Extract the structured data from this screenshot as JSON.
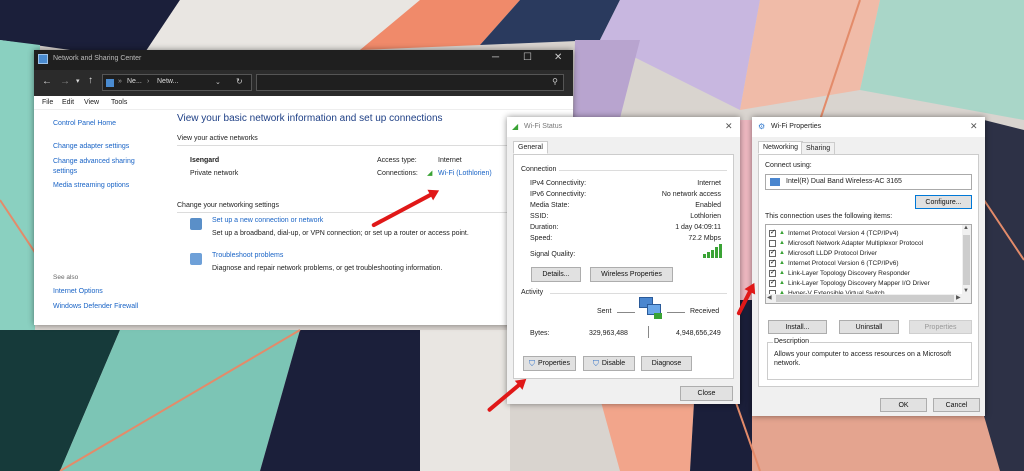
{
  "network_center": {
    "title": "Network and Sharing Center",
    "nav": {
      "path1": "Ne...",
      "path2": "Netw..."
    },
    "menu": [
      "File",
      "Edit",
      "View",
      "Tools"
    ],
    "sidebar": {
      "items": [
        "Control Panel Home",
        "Change adapter settings",
        "Change advanced sharing settings",
        "Media streaming options"
      ],
      "see_also_heading": "See also",
      "see_also": [
        "Internet Options",
        "Windows Defender Firewall"
      ]
    },
    "main": {
      "heading": "View your basic network information and set up connections",
      "active_heading": "View your active networks",
      "network_name": "Isengard",
      "network_type": "Private network",
      "access_type_label": "Access type:",
      "access_type_value": "Internet",
      "connections_label": "Connections:",
      "connections_value": "Wi-Fi (Lothlorien)",
      "change_heading": "Change your networking settings",
      "task1_title": "Set up a new connection or network",
      "task1_desc": "Set up a broadband, dial-up, or VPN connection; or set up a router or access point.",
      "task2_title": "Troubleshoot problems",
      "task2_desc": "Diagnose and repair network problems, or get troubleshooting information."
    }
  },
  "wifi_status": {
    "title": "Wi-Fi Status",
    "tab": "General",
    "connection_heading": "Connection",
    "rows": [
      {
        "label": "IPv4 Connectivity:",
        "value": "Internet"
      },
      {
        "label": "IPv6 Connectivity:",
        "value": "No network access"
      },
      {
        "label": "Media State:",
        "value": "Enabled"
      },
      {
        "label": "SSID:",
        "value": "Lothlorien"
      },
      {
        "label": "Duration:",
        "value": "1 day 04:09:11"
      },
      {
        "label": "Speed:",
        "value": "72.2 Mbps"
      }
    ],
    "signal_label": "Signal Quality:",
    "details_btn": "Details...",
    "wireless_props_btn": "Wireless Properties",
    "activity_heading": "Activity",
    "sent_label": "Sent",
    "received_label": "Received",
    "bytes_label": "Bytes:",
    "bytes_sent": "329,963,488",
    "bytes_received": "4,948,656,249",
    "properties_btn": "Properties",
    "disable_btn": "Disable",
    "diagnose_btn": "Diagnose",
    "close_btn": "Close"
  },
  "wifi_props": {
    "title": "Wi-Fi Properties",
    "tabs": [
      "Networking",
      "Sharing"
    ],
    "connect_using_label": "Connect using:",
    "adapter": "Intel(R) Dual Band Wireless-AC 3165",
    "configure_btn": "Configure...",
    "items_label": "This connection uses the following items:",
    "items": [
      {
        "label": "Internet Protocol Version 4 (TCP/IPv4)",
        "checked": true
      },
      {
        "label": "Microsoft Network Adapter Multiplexor Protocol",
        "checked": false
      },
      {
        "label": "Microsoft LLDP Protocol Driver",
        "checked": true
      },
      {
        "label": "Internet Protocol Version 6 (TCP/IPv6)",
        "checked": true
      },
      {
        "label": "Link-Layer Topology Discovery Responder",
        "checked": true
      },
      {
        "label": "Link-Layer Topology Discovery Mapper I/O Driver",
        "checked": true
      },
      {
        "label": "Hyper-V Extensible Virtual Switch",
        "checked": false
      }
    ],
    "install_btn": "Install...",
    "uninstall_btn": "Uninstall",
    "properties_btn": "Properties",
    "description_heading": "Description",
    "description": "Allows your computer to access resources on a Microsoft network.",
    "ok_btn": "OK",
    "cancel_btn": "Cancel"
  },
  "colors": {
    "accent": "#1a64c6",
    "arrow": "#e01818",
    "signal": "#3aa335",
    "titlebar_dark": "#1f1f1f"
  }
}
